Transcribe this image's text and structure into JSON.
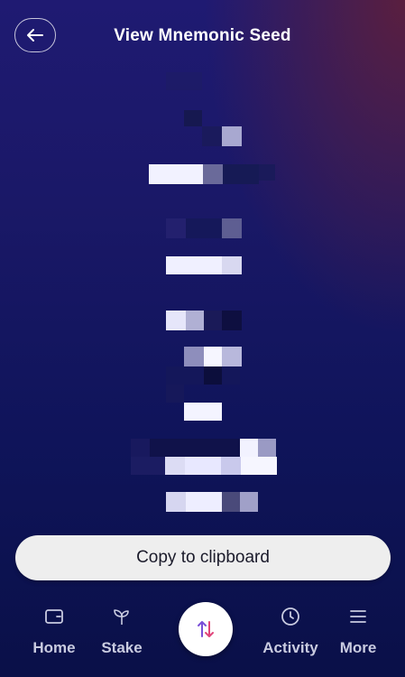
{
  "header": {
    "title": "View Mnemonic Seed",
    "back_icon": "arrow-left-icon"
  },
  "seed": {
    "note": "",
    "word_count_visible": 12
  },
  "actions": {
    "copy_label": "Copy to clipboard"
  },
  "nav": {
    "items": [
      {
        "label": "Home",
        "icon": "wallet-icon"
      },
      {
        "label": "Stake",
        "icon": "sprout-icon"
      },
      {
        "label": "",
        "icon": "swap-arrows-icon"
      },
      {
        "label": "Activity",
        "icon": "clock-icon"
      },
      {
        "label": "More",
        "icon": "menu-icon"
      }
    ]
  },
  "colors": {
    "background_top": "#1f1a72",
    "background_bottom": "#0a1048",
    "swap_up": "#7a4fd8",
    "swap_down": "#e0457a",
    "nav_text": "#c9cbe0"
  }
}
